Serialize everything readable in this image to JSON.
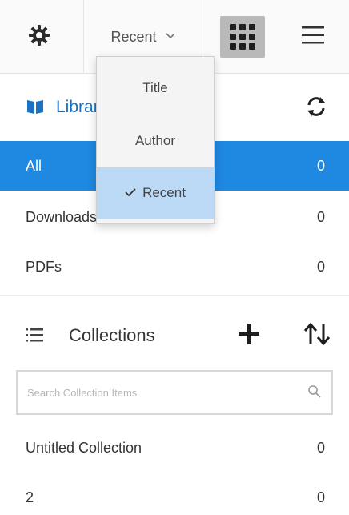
{
  "toolbar": {
    "settings_icon": "gear-icon",
    "sort_value": "Recent",
    "grid_view_icon": "grid-view-icon",
    "menu_icon": "hamburger-menu-icon"
  },
  "sort_menu": {
    "options": [
      "Title",
      "Author",
      "Recent"
    ],
    "selected": "Recent"
  },
  "library": {
    "title": "Library",
    "icon": "book-icon",
    "refresh_icon": "sync-icon",
    "items": [
      {
        "label": "All",
        "count": "0",
        "selected": true
      },
      {
        "label": "Downloads",
        "count": "0",
        "selected": false
      },
      {
        "label": "PDFs",
        "count": "0",
        "selected": false
      }
    ]
  },
  "collections": {
    "title": "Collections",
    "list_icon": "list-icon",
    "add_icon": "plus-icon",
    "sort_icon": "sort-arrows-icon",
    "search_placeholder": "Search Collection Items",
    "items": [
      {
        "label": "Untitled Collection",
        "count": "0"
      },
      {
        "label": "2",
        "count": "0"
      }
    ]
  },
  "colors": {
    "accent": "#1f88e0",
    "link": "#1a73c2",
    "menu_selected": "#bcdaf6"
  }
}
